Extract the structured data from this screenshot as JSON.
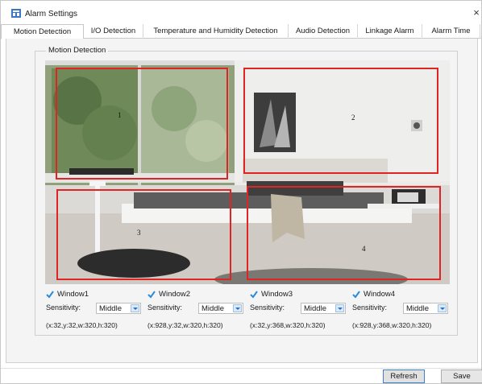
{
  "window": {
    "title": "Alarm Settings",
    "close": "×"
  },
  "tabs": [
    {
      "label": "Motion Detection",
      "active": true
    },
    {
      "label": "I/O Detection",
      "active": false
    },
    {
      "label": "Temperature and Humidity Detection",
      "active": false
    },
    {
      "label": "Audio Detection",
      "active": false
    },
    {
      "label": "Linkage Alarm",
      "active": false
    },
    {
      "label": "Alarm Time",
      "active": false
    }
  ],
  "group": {
    "label": "Motion Detection"
  },
  "regions": [
    {
      "num": "1"
    },
    {
      "num": "2"
    },
    {
      "num": "3"
    },
    {
      "num": "4"
    }
  ],
  "windows": [
    {
      "label": "Window1",
      "checked": true,
      "sensitivity_label": "Sensitivity:",
      "sensitivity": "Middle",
      "coords": "(x:32,y:32,w:320,h:320)"
    },
    {
      "label": "Window2",
      "checked": true,
      "sensitivity_label": "Sensitivity:",
      "sensitivity": "Middle",
      "coords": "(x:928,y:32,w:320,h:320)"
    },
    {
      "label": "Window3",
      "checked": true,
      "sensitivity_label": "Sensitivity:",
      "sensitivity": "Middle",
      "coords": "(x:32,y:368,w:320,h:320)"
    },
    {
      "label": "Window4",
      "checked": true,
      "sensitivity_label": "Sensitivity:",
      "sensitivity": "Middle",
      "coords": "(x:928,y:368,w:320,h:320)"
    }
  ],
  "buttons": {
    "refresh": "Refresh",
    "save": "Save"
  },
  "colors": {
    "region_border": "#e02424",
    "checkmark": "#2a8ad8",
    "accent": "#3c7fd1"
  }
}
